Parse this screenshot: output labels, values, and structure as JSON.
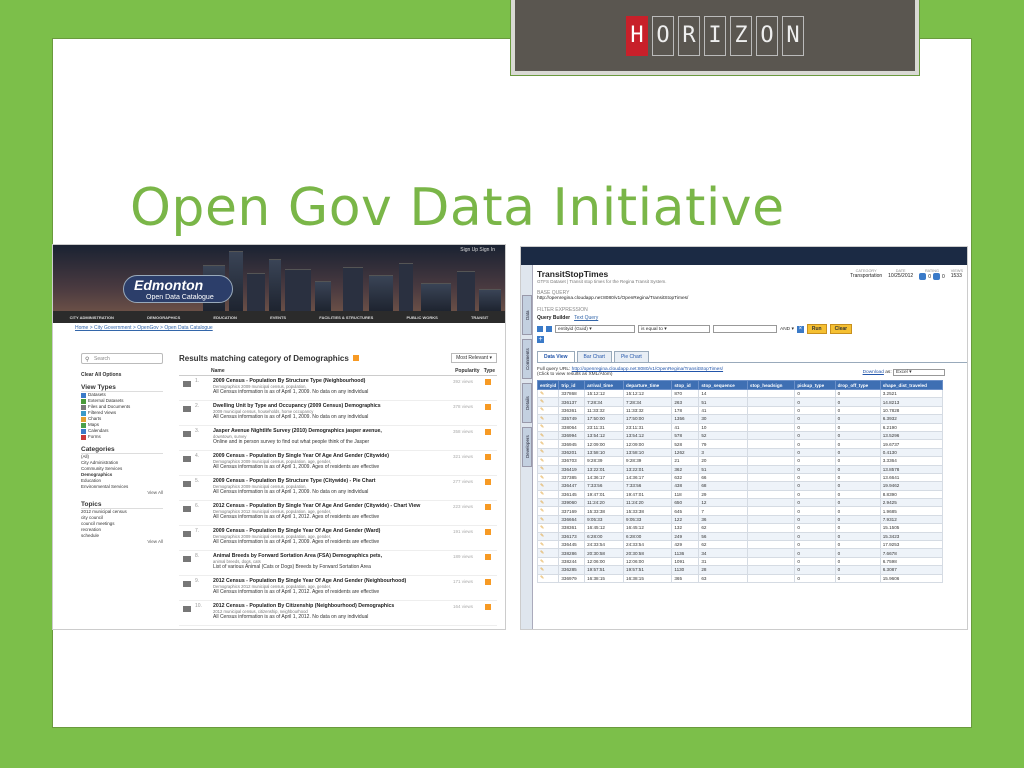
{
  "logo": {
    "letters": [
      "H",
      "O",
      "R",
      "I",
      "Z",
      "O",
      "N"
    ]
  },
  "slide": {
    "title": "Open Gov Data Initiative"
  },
  "edmonton": {
    "sign_links": "Sign Up   Sign In",
    "logo_big": "Edmonton",
    "logo_small": "Open Data Catalogue",
    "nav": [
      "CITY ADMINISTRATION",
      "DEMOGRAPHICS",
      "EDUCATION",
      "EVENTS",
      "FACILITIES & STRUCTURES",
      "PUBLIC WORKS",
      "TRANSIT"
    ],
    "breadcrumb": "Home > City Government > OpenGov > Open Data Catalogue",
    "search_placeholder": "Search",
    "clear_all": "Clear All Options",
    "view_types_heading": "View Types",
    "view_types": [
      {
        "label": "Datasets",
        "color": "#3a7ac8"
      },
      {
        "label": "External Datasets",
        "color": "#4a9a3a"
      },
      {
        "label": "Files and Documents",
        "color": "#7a7a7a"
      },
      {
        "label": "Filtered Views",
        "color": "#3a9ac8"
      },
      {
        "label": "Charts",
        "color": "#e0a030"
      },
      {
        "label": "Maps",
        "color": "#4aa04a"
      },
      {
        "label": "Calendars",
        "color": "#3a7ac8"
      },
      {
        "label": "Forms",
        "color": "#c83a3a"
      }
    ],
    "categories_heading": "Categories",
    "categories": [
      "(All)",
      "City Administration",
      "Community Services",
      "Demographics",
      "Education",
      "Environmental Services"
    ],
    "view_all": "View All",
    "topics_heading": "Topics",
    "topics": [
      "2012 municipal census",
      "city council",
      "council meetings",
      "recreation",
      "schedule"
    ],
    "results_heading": "Results matching category of Demographics",
    "relevance": "Most Relevant",
    "col_name": "Name",
    "col_popularity": "Popularity",
    "col_type": "Type",
    "results": [
      {
        "num": "1.",
        "title": "2009 Census - Population By Structure Type (Neighbourhood)",
        "sub": "Demographics   2009 municipal census, population,",
        "desc": "All Census information is as of April 1, 2009. No data on any individual",
        "views": "392 views"
      },
      {
        "num": "2.",
        "title": "Dwelling Unit by Type and Occupancy (2009 Census)  Demographics",
        "sub": "2009 municipal census, households, home occupancy",
        "desc": "All Census information is as of April 1, 2009. No data on any individual",
        "views": "378 views"
      },
      {
        "num": "3.",
        "title": "Jasper Avenue Nightlife Survey (2010)  Demographics  jasper avenue,",
        "sub": "downtown, survey",
        "desc": "Online and in person survey to find out what people think of the Jasper",
        "views": "358 views"
      },
      {
        "num": "4.",
        "title": "2009 Census - Population By Single Year Of Age And Gender (Citywide)",
        "sub": "Demographics   2009 municipal census, population, age, gender,",
        "desc": "All Census information is as of April 1, 2009. Ages of residents are effective",
        "views": "321 views"
      },
      {
        "num": "5.",
        "title": "2009 Census - Population By Structure Type (Citywide) - Pie Chart",
        "sub": "Demographics   2009 municipal census, population,",
        "desc": "All Census information is as of April 1, 2009. No data on any individual",
        "views": "277 views"
      },
      {
        "num": "6.",
        "title": "2012 Census - Population By Single Year Of Age And Gender (Citywide) - Chart View",
        "sub": "Demographics   2012 municipal census, population, age, gender,",
        "desc": "All Census information is as of April 1, 2012. Ages of residents are effective",
        "views": "223 views"
      },
      {
        "num": "7.",
        "title": "2009 Census - Population By Single Year Of Age And Gender (Ward)",
        "sub": "Demographics   2009 municipal census, population, age, gender,",
        "desc": "All Census information is as of April 1, 2009. Ages of residents are effective",
        "views": "191 views"
      },
      {
        "num": "8.",
        "title": "Animal Breeds by Forward Sortation Area (FSA)  Demographics  pets,",
        "sub": "animal breeds, dogs, cats",
        "desc": "List of various Animal (Cats or Dogs) Breeds by Forward Sortation Area",
        "views": "189 views"
      },
      {
        "num": "9.",
        "title": "2012 Census - Population By Single Year Of Age And Gender (Neighbourhood)",
        "sub": "Demographics   2012 municipal census, population, age, gender,",
        "desc": "All Census information is as of April 1, 2012. Ages of residents are effective",
        "views": "171 views"
      },
      {
        "num": "10.",
        "title": "2012 Census - Population By Citizenship (Neighbourhood)  Demographics",
        "sub": "2012 municipal census, citizenship, neighbourhood",
        "desc": "All Census information is as of April 1, 2012. No data on any individual",
        "views": "164 views"
      }
    ]
  },
  "regina": {
    "side_tabs": [
      "Data",
      "Comments",
      "Details",
      "Developers"
    ],
    "title": "TransitStopTimes",
    "subtitle": "GTFS Dataset | Transit stop times for the Regina Transit System.",
    "meta_headers": [
      "CATEGORY",
      "DATE",
      "RATING",
      "VIEWS"
    ],
    "category": "Transportation",
    "date": "10/25/2012",
    "rating_up": "0",
    "rating_down": "0",
    "views": "1533",
    "base_query_label": "BASE QUERY",
    "base_query": "http://openregina.cloudapp.net:8080/v1/OpenRegina/TransitStopTimes/",
    "filter_label": "FILTER EXPRESSION",
    "query_builder": "Query Builder",
    "text_query": "Text Query",
    "filter_field": "entityid (Guid)",
    "filter_op": "is equal to",
    "filter_join": "AND",
    "run": "Run",
    "clear": "Clear",
    "view_tabs": [
      "Data View",
      "Bar Chart",
      "Pie Chart"
    ],
    "full_query_label": "Full query URL:",
    "full_query_url": "http://openregina.cloudapp.net:8080/v1/OpenRegina/TransitStopTimes/",
    "click_note": "(Click to view results as XML/Atom)",
    "download": "Download",
    "download_as": "as:",
    "download_format": "Excel",
    "columns": [
      "entityid",
      "trip_id",
      "arrival_time",
      "departure_time",
      "stop_id",
      "stop_sequence",
      "stop_headsign",
      "pickup_type",
      "drop_off_type",
      "shape_dist_traveled"
    ],
    "rows": [
      [
        "337868",
        "15:12:12",
        "15:12:12",
        "870",
        "14",
        "",
        "0",
        "0",
        "3.2521"
      ],
      [
        "336137",
        "7:28:34",
        "7:28:34",
        "263",
        "51",
        "",
        "0",
        "0",
        "14.8213"
      ],
      [
        "336361",
        "11:33:32",
        "11:33:32",
        "178",
        "41",
        "",
        "0",
        "0",
        "10.7828"
      ],
      [
        "335749",
        "17:50:00",
        "17:50:00",
        "1356",
        "30",
        "",
        "0",
        "0",
        "6.3932"
      ],
      [
        "338064",
        "23:11:31",
        "23:11:31",
        "41",
        "10",
        "",
        "0",
        "0",
        "6.2190"
      ],
      [
        "336994",
        "13:54:12",
        "13:54:12",
        "578",
        "52",
        "",
        "0",
        "0",
        "13.5296"
      ],
      [
        "336945",
        "12:09:00",
        "12:09:00",
        "528",
        "79",
        "",
        "0",
        "0",
        "19.6737"
      ],
      [
        "336201",
        "13:58:10",
        "13:58:10",
        "1262",
        "3",
        "",
        "0",
        "0",
        "0.4130"
      ],
      [
        "336703",
        "9:28:39",
        "9:28:39",
        "21",
        "20",
        "",
        "0",
        "0",
        "3.3364"
      ],
      [
        "336419",
        "13:22:01",
        "13:22:01",
        "362",
        "51",
        "",
        "0",
        "0",
        "13.8578"
      ],
      [
        "337385",
        "14:36:17",
        "14:36:17",
        "632",
        "66",
        "",
        "0",
        "0",
        "13.6641"
      ],
      [
        "336447",
        "7:33:56",
        "7:33:56",
        "438",
        "68",
        "",
        "0",
        "0",
        "19.9462"
      ],
      [
        "336145",
        "19:47:01",
        "19:47:01",
        "118",
        "29",
        "",
        "0",
        "0",
        "8.8390"
      ],
      [
        "339060",
        "11:24:20",
        "11:24:20",
        "650",
        "12",
        "",
        "0",
        "0",
        "2.9425"
      ],
      [
        "337169",
        "15:33:38",
        "15:33:38",
        "645",
        "7",
        "",
        "0",
        "0",
        "1.9685"
      ],
      [
        "336664",
        "9:05:33",
        "9:05:33",
        "122",
        "36",
        "",
        "0",
        "0",
        "7.9312"
      ],
      [
        "338361",
        "16:45:12",
        "16:45:12",
        "132",
        "62",
        "",
        "0",
        "0",
        "15.1505"
      ],
      [
        "336173",
        "6:28:00",
        "6:28:00",
        "249",
        "56",
        "",
        "0",
        "0",
        "15.3423"
      ],
      [
        "336445",
        "24:33:54",
        "24:33:54",
        "429",
        "62",
        "",
        "0",
        "0",
        "17.9253"
      ],
      [
        "338286",
        "20:30:58",
        "20:30:58",
        "1136",
        "34",
        "",
        "0",
        "0",
        "7.6678"
      ],
      [
        "338244",
        "12:06:00",
        "12:06:00",
        "1091",
        "31",
        "",
        "0",
        "0",
        "6.7598"
      ],
      [
        "336285",
        "19:57:51",
        "19:57:51",
        "1130",
        "28",
        "",
        "0",
        "0",
        "6.3087"
      ],
      [
        "336979",
        "16:38:15",
        "16:38:15",
        "365",
        "63",
        "",
        "0",
        "0",
        "15.9606"
      ]
    ]
  }
}
